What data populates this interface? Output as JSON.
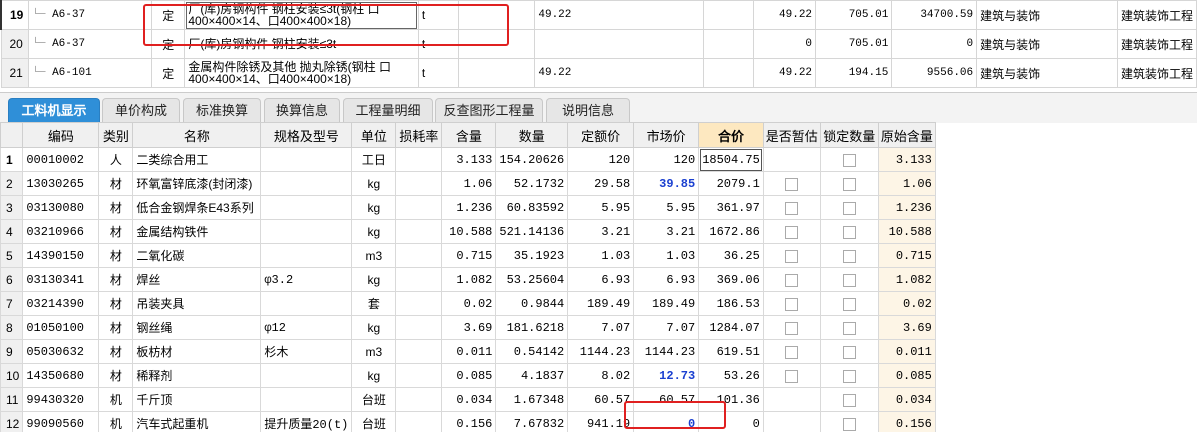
{
  "top_rows": [
    {
      "num": "19",
      "code": "A6-37",
      "type": "定",
      "name": "厂(库)房钢构件 钢柱安装≤3t(钢柱 口400×400×14、口400×400×18)",
      "unit": "t",
      "qty": "49.22",
      "qty2": "49.22",
      "price": "705.01",
      "total": "34700.59",
      "cat": "建筑与装饰",
      "prof": "建筑装饰工程"
    },
    {
      "num": "20",
      "code": "A6-37",
      "type": "定",
      "name": "厂(库)房钢构件 钢柱安装≤3t",
      "unit": "t",
      "qty": "",
      "qty2": "0",
      "price": "705.01",
      "total": "0",
      "cat": "建筑与装饰",
      "prof": "建筑装饰工程"
    },
    {
      "num": "21",
      "code": "A6-101",
      "type": "定",
      "name": "金属构件除锈及其他 抛丸除锈(钢柱 口400×400×14、口400×400×18)",
      "unit": "t",
      "qty": "49.22",
      "qty2": "49.22",
      "price": "194.15",
      "total": "9556.06",
      "cat": "建筑与装饰",
      "prof": "建筑装饰工程"
    }
  ],
  "tabs": [
    "工料机显示",
    "单价构成",
    "标准换算",
    "换算信息",
    "工程量明细",
    "反查图形工程量",
    "说明信息"
  ],
  "columns": [
    "编码",
    "类别",
    "名称",
    "规格及型号",
    "单位",
    "损耗率",
    "含量",
    "数量",
    "定额价",
    "市场价",
    "合价",
    "是否暂估",
    "锁定数量",
    "原始含量"
  ],
  "rows": [
    {
      "n": "1",
      "code": "00010002",
      "cat": "人",
      "name": "二类综合用工",
      "spec": "",
      "unit": "工日",
      "loss": "",
      "content": "3.133",
      "qty": "154.20626",
      "quota": "120",
      "market": "120",
      "total": "18504.75",
      "est": false,
      "lock": true,
      "orig": "3.133"
    },
    {
      "n": "2",
      "code": "13030265",
      "cat": "材",
      "name": "环氧富锌底漆(封闭漆)",
      "spec": "",
      "unit": "kg",
      "loss": "",
      "content": "1.06",
      "qty": "52.1732",
      "quota": "29.58",
      "market": "39.85",
      "total": "2079.1",
      "est": true,
      "lock": true,
      "orig": "1.06"
    },
    {
      "n": "3",
      "code": "03130080",
      "cat": "材",
      "name": "低合金钢焊条E43系列",
      "spec": "",
      "unit": "kg",
      "loss": "",
      "content": "1.236",
      "qty": "60.83592",
      "quota": "5.95",
      "market": "5.95",
      "total": "361.97",
      "est": true,
      "lock": true,
      "orig": "1.236"
    },
    {
      "n": "4",
      "code": "03210966",
      "cat": "材",
      "name": "金属结构铁件",
      "spec": "",
      "unit": "kg",
      "loss": "",
      "content": "10.588",
      "qty": "521.14136",
      "quota": "3.21",
      "market": "3.21",
      "total": "1672.86",
      "est": true,
      "lock": true,
      "orig": "10.588"
    },
    {
      "n": "5",
      "code": "14390150",
      "cat": "材",
      "name": "二氧化碳",
      "spec": "",
      "unit": "m3",
      "loss": "",
      "content": "0.715",
      "qty": "35.1923",
      "quota": "1.03",
      "market": "1.03",
      "total": "36.25",
      "est": true,
      "lock": true,
      "orig": "0.715"
    },
    {
      "n": "6",
      "code": "03130341",
      "cat": "材",
      "name": "焊丝",
      "spec": "φ3.2",
      "unit": "kg",
      "loss": "",
      "content": "1.082",
      "qty": "53.25604",
      "quota": "6.93",
      "market": "6.93",
      "total": "369.06",
      "est": true,
      "lock": true,
      "orig": "1.082"
    },
    {
      "n": "7",
      "code": "03214390",
      "cat": "材",
      "name": "吊装夹具",
      "spec": "",
      "unit": "套",
      "loss": "",
      "content": "0.02",
      "qty": "0.9844",
      "quota": "189.49",
      "market": "189.49",
      "total": "186.53",
      "est": true,
      "lock": true,
      "orig": "0.02"
    },
    {
      "n": "8",
      "code": "01050100",
      "cat": "材",
      "name": "钢丝绳",
      "spec": "φ12",
      "unit": "kg",
      "loss": "",
      "content": "3.69",
      "qty": "181.6218",
      "quota": "7.07",
      "market": "7.07",
      "total": "1284.07",
      "est": true,
      "lock": true,
      "orig": "3.69"
    },
    {
      "n": "9",
      "code": "05030632",
      "cat": "材",
      "name": "板枋材",
      "spec": "杉木",
      "unit": "m3",
      "loss": "",
      "content": "0.011",
      "qty": "0.54142",
      "quota": "1144.23",
      "market": "1144.23",
      "total": "619.51",
      "est": true,
      "lock": true,
      "orig": "0.011"
    },
    {
      "n": "10",
      "code": "14350680",
      "cat": "材",
      "name": "稀释剂",
      "spec": "",
      "unit": "kg",
      "loss": "",
      "content": "0.085",
      "qty": "4.1837",
      "quota": "8.02",
      "market": "12.73",
      "total": "53.26",
      "est": true,
      "lock": true,
      "orig": "0.085"
    },
    {
      "n": "11",
      "code": "99430320",
      "cat": "机",
      "name": "千斤顶",
      "spec": "",
      "unit": "台班",
      "loss": "",
      "content": "0.034",
      "qty": "1.67348",
      "quota": "60.57",
      "market": "60.57",
      "total": "101.36",
      "est": false,
      "lock": true,
      "orig": "0.034"
    },
    {
      "n": "12",
      "code": "99090560",
      "cat": "机",
      "name": "汽车式起重机",
      "spec": "提升质量20(t)",
      "unit": "台班",
      "loss": "",
      "content": "0.156",
      "qty": "7.67832",
      "quota": "941.19",
      "market": "0",
      "total": "0",
      "est": false,
      "lock": true,
      "orig": "0.156"
    }
  ],
  "colors": {
    "accent": "#2f8fd8",
    "highlight": "#e02020",
    "market_changed": "#1a3fd0"
  }
}
